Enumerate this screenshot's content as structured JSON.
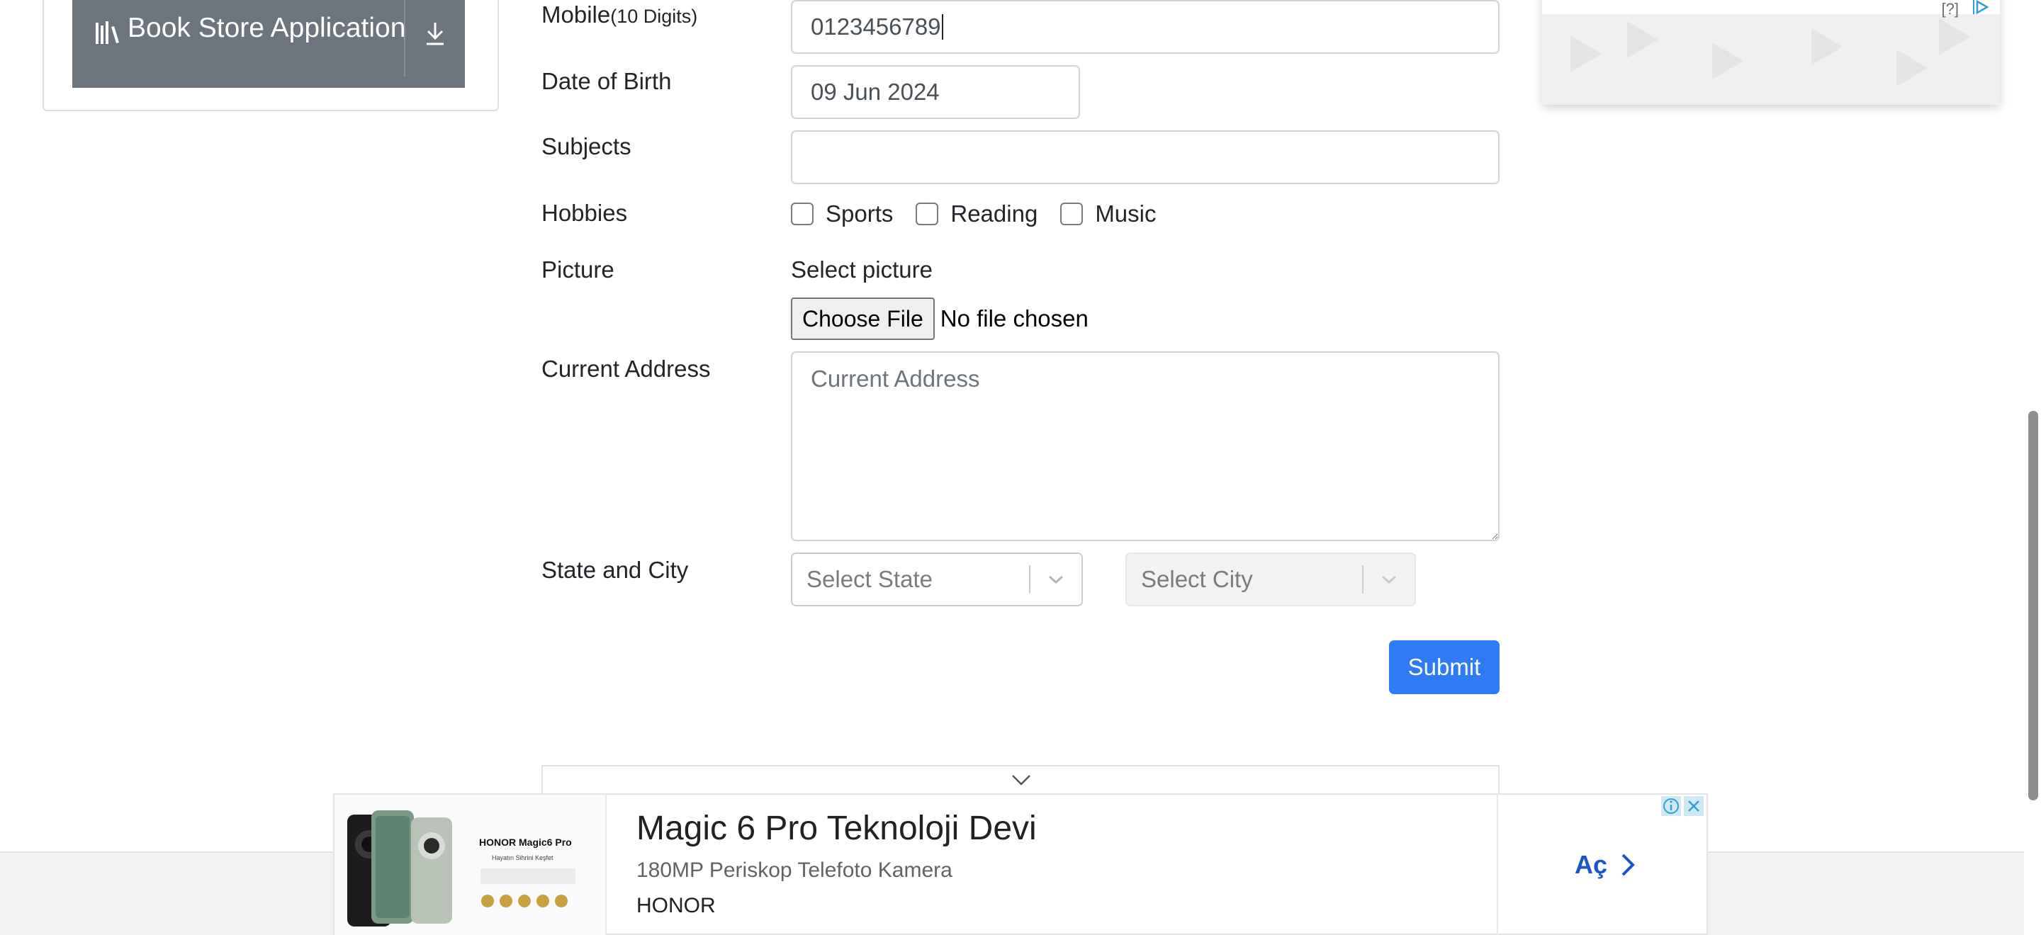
{
  "sidebar": {
    "book_store_label": "Book Store Application",
    "book_icon": "books-icon",
    "download_icon": "download-icon"
  },
  "form": {
    "mobile": {
      "label": "Mobile",
      "hint": "(10 Digits)",
      "value": "0123456789"
    },
    "dob": {
      "label": "Date of Birth",
      "value": "09 Jun 2024"
    },
    "subjects": {
      "label": "Subjects",
      "value": ""
    },
    "hobbies": {
      "label": "Hobbies",
      "options": [
        {
          "label": "Sports",
          "checked": false
        },
        {
          "label": "Reading",
          "checked": false
        },
        {
          "label": "Music",
          "checked": false
        }
      ]
    },
    "picture": {
      "label": "Picture",
      "select_text": "Select picture",
      "button": "Choose File",
      "status": "No file chosen"
    },
    "address": {
      "label": "Current Address",
      "placeholder": "Current Address"
    },
    "state_city": {
      "label": "State and City",
      "state_placeholder": "Select State",
      "city_placeholder": "Select City"
    },
    "submit": "Submit"
  },
  "ad_top_right": {
    "question": "[?]"
  },
  "banner_ad": {
    "title": "Magic 6 Pro Teknoloji Devi",
    "subtitle": "180MP Periskop Telefoto Kamera",
    "brand": "HONOR",
    "cta": "Aç",
    "product_line": "HONOR Magic6 Pro",
    "tagline": "Hayatın Sihrini Keşfet"
  },
  "colors": {
    "primary": "#2f7bf5",
    "secondary": "#6c757d",
    "cta": "#1a55c9"
  }
}
